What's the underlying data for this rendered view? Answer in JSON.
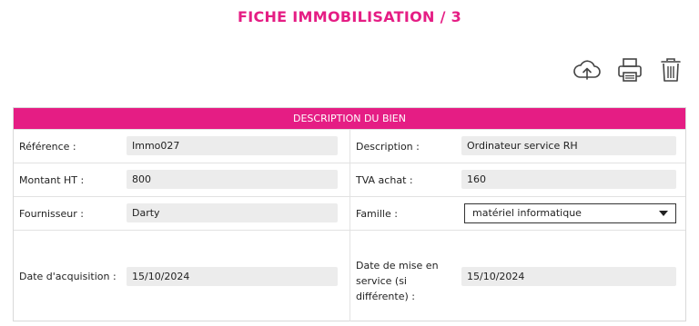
{
  "page": {
    "title": "FICHE IMMOBILISATION / 3"
  },
  "toolbar": {
    "upload_icon": "cloud-upload-icon",
    "print_icon": "printer-icon",
    "delete_icon": "trash-icon"
  },
  "section": {
    "header": "DESCRIPTION DU BIEN"
  },
  "fields": {
    "reference": {
      "label": "Référence :",
      "value": "Immo027"
    },
    "description": {
      "label": "Description :",
      "value": "Ordinateur service RH"
    },
    "montant_ht": {
      "label": "Montant HT :",
      "value": "800"
    },
    "tva_achat": {
      "label": "TVA achat :",
      "value": "160"
    },
    "fournisseur": {
      "label": "Fournisseur :",
      "value": "Darty"
    },
    "famille": {
      "label": "Famille :",
      "value": "matériel informatique"
    },
    "date_acquisition": {
      "label": "Date d'acquisition :",
      "value": "15/10/2024"
    },
    "date_mise_service": {
      "label_lines": [
        "Date de mise en",
        "service (si",
        "différente) :"
      ],
      "value": "15/10/2024"
    }
  },
  "colors": {
    "accent": "#e51d84",
    "field_bg": "#ececec"
  }
}
